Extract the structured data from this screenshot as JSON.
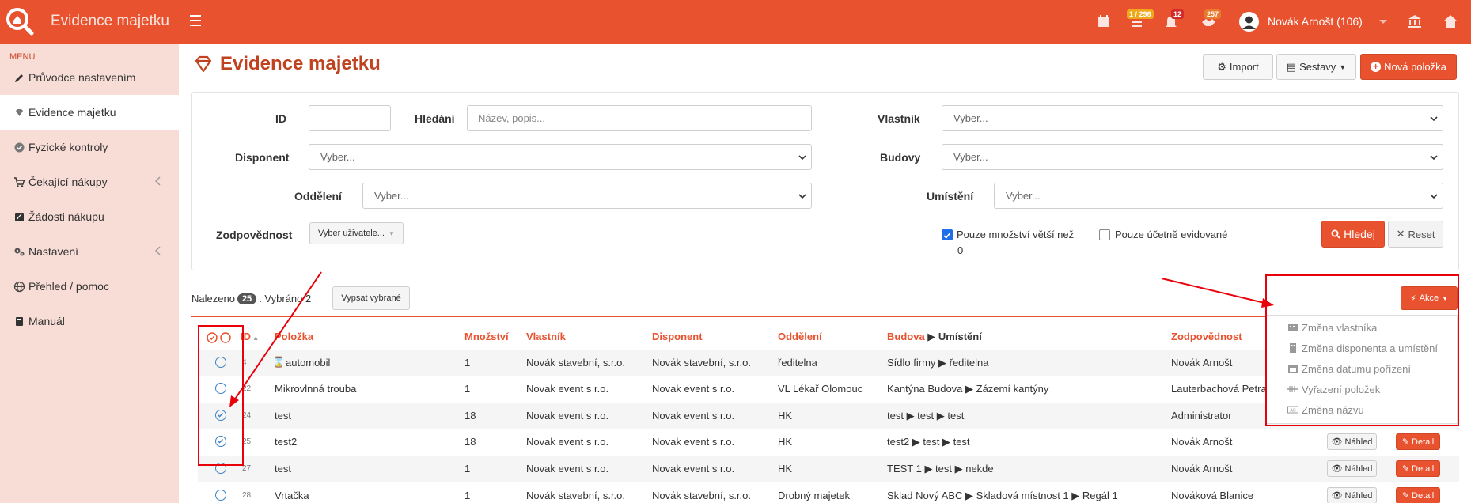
{
  "app": {
    "title": "Evidence majetku"
  },
  "topbar": {
    "tasks_badge": "1 / 296",
    "notifications_badge": "12",
    "messages_badge": "257",
    "user_name": "Novák Arnošt (106)"
  },
  "sidebar": {
    "menu_header": "MENU",
    "items": [
      {
        "label": "Průvodce nastavením"
      },
      {
        "label": "Evidence majetku"
      },
      {
        "label": "Fyzické kontroly"
      },
      {
        "label": "Čekající nákupy"
      },
      {
        "label": "Žádosti nákupu"
      },
      {
        "label": "Nastavení"
      },
      {
        "label": "Přehled / pomoc"
      },
      {
        "label": "Manuál"
      }
    ]
  },
  "page": {
    "title": "Evidence majetku",
    "import_label": "Import",
    "reports_label": "Sestavy",
    "new_item_label": "Nová položka"
  },
  "filters": {
    "id_label": "ID",
    "search_label": "Hledání",
    "search_placeholder": "Název, popis...",
    "owner_label": "Vlastník",
    "owner_value": "Vyber...",
    "disponent_label": "Disponent",
    "disponent_value": "Vyber...",
    "buildings_label": "Budovy",
    "buildings_value": "Vyber...",
    "department_label": "Oddělení",
    "department_value": "Vyber...",
    "location_label": "Umístění",
    "location_value": "Vyber...",
    "responsibility_label": "Zodpovědnost",
    "responsibility_value": "Vyber uživatele...",
    "qty_check_label": "Pouze množství větší než",
    "qty_value": "0",
    "accounting_check_label": "Pouze účetně evidované",
    "search_button": "Hledej",
    "reset_button": "Reset"
  },
  "results": {
    "found_label": "Nalezeno",
    "found_count": "25",
    "selected_label": ". Vybráno 2",
    "list_selected_button": "Vypsat vybrané",
    "actions_button": "Akce"
  },
  "table": {
    "headers": {
      "id": "ID",
      "item": "Položka",
      "qty": "Množství",
      "owner": "Vlastník",
      "disponent": "Disponent",
      "department": "Oddělení",
      "building": "Budova",
      "location": "Umístění",
      "responsibility": "Zodpovědnost"
    },
    "preview_label": "Náhled",
    "detail_label": "Detail",
    "rows": [
      {
        "id": "4",
        "item": "automobil",
        "qty": "1",
        "owner": "Novák stavební, s.r.o.",
        "disponent": "Novák stavební, s.r.o.",
        "department": "ředitelna",
        "location": "Sídlo firmy ▶ ředitelna",
        "responsibility": "Novák Arnošt",
        "selected": false
      },
      {
        "id": "22",
        "item": "Mikrovlnná trouba",
        "qty": "1",
        "owner": "Novak event s r.o.",
        "disponent": "Novak event s r.o.",
        "department": "VL Lékař Olomouc",
        "location": "Kantýna Budova ▶ Zázemí kantýny",
        "responsibility": "Lauterbachová Petra",
        "selected": false
      },
      {
        "id": "24",
        "item": "test",
        "qty": "18",
        "owner": "Novak event s r.o.",
        "disponent": "Novak event s r.o.",
        "department": "HK",
        "location": "test ▶ test ▶ test",
        "responsibility": "Administrator",
        "selected": true
      },
      {
        "id": "25",
        "item": "test2",
        "qty": "18",
        "owner": "Novak event s r.o.",
        "disponent": "Novak event s r.o.",
        "department": "HK",
        "location": "test2 ▶ test ▶ test",
        "responsibility": "Novák Arnošt",
        "selected": true
      },
      {
        "id": "27",
        "item": "test",
        "qty": "1",
        "owner": "Novak event s r.o.",
        "disponent": "Novak event s r.o.",
        "department": "HK",
        "location": "TEST 1 ▶ test ▶ nekde",
        "responsibility": "Novák Arnošt",
        "selected": false
      },
      {
        "id": "28",
        "item": "Vrtačka",
        "qty": "1",
        "owner": "Novák stavební, s.r.o.",
        "disponent": "Novák stavební, s.r.o.",
        "department": "Drobný majetek",
        "location": "Sklad Nový ABC ▶ Skladová místnost 1 ▶ Regál 1",
        "responsibility": "Nováková Blanice",
        "selected": false
      }
    ]
  },
  "actions_menu": {
    "items": [
      {
        "label": "Změna vlastníka",
        "icon": "building-icon"
      },
      {
        "label": "Změna disponenta a umístění",
        "icon": "office-icon"
      },
      {
        "label": "Změna datumu pořízení",
        "icon": "calendar-icon"
      },
      {
        "label": "Vyřazení položek",
        "icon": "strikethrough-icon"
      },
      {
        "label": "Změna názvu",
        "icon": "text-box-icon"
      }
    ]
  },
  "colors": {
    "brand": "#e8522f",
    "sidebar": "#f8dcd6",
    "annotation": "#e8000a"
  }
}
